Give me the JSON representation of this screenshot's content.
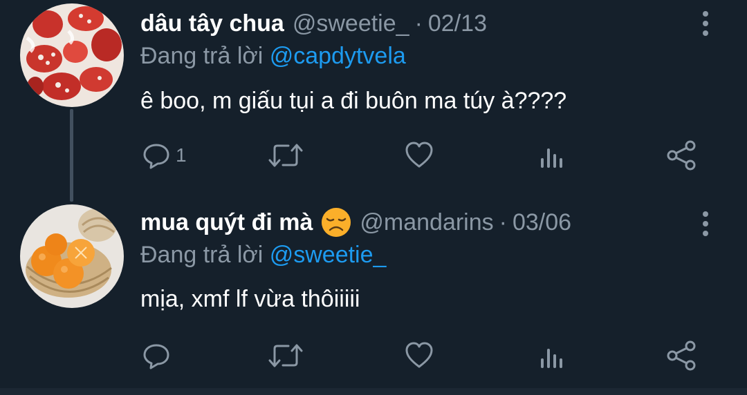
{
  "tweets": [
    {
      "display_name": "dâu tây chua",
      "emoji": "",
      "handle": "@sweetie_",
      "separator": "·",
      "date": "02/13",
      "replying_prefix": "Đang trả lời",
      "replying_to": "@capdytvela",
      "text": "ê boo, m giấu tụi a đi buôn ma túy à????",
      "reply_count": "1",
      "avatar": "strawberries-in-milk"
    },
    {
      "display_name": "mua quýt đi mà",
      "emoji": "disappointed-face-emoji",
      "handle": "@mandarins",
      "separator": "·",
      "date": "03/06",
      "replying_prefix": "Đang trả lời",
      "replying_to": "@sweetie_",
      "text": "mịa, xmf lf vừa thôiiiii",
      "reply_count": "",
      "avatar": "oranges-in-basket"
    }
  ],
  "icons": {
    "reply": "reply-icon",
    "retweet": "retweet-icon",
    "like": "heart-icon",
    "views": "views-icon",
    "share": "share-icon",
    "more": "more-vertical-icon"
  },
  "colors": {
    "background": "#15202b",
    "text": "#ffffff",
    "muted": "#8b98a5",
    "accent": "#1d9bf0",
    "thread_line": "#42505f"
  }
}
